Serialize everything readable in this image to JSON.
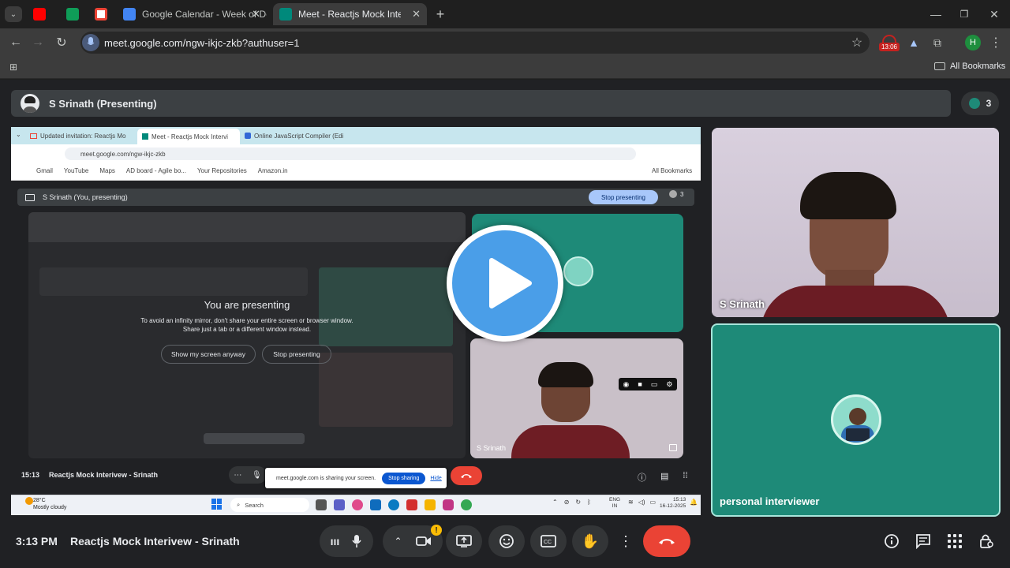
{
  "browser": {
    "tabs": [
      {
        "label": "",
        "icon": "youtube-icon"
      },
      {
        "label": "",
        "icon": "sheets-icon"
      },
      {
        "label": "",
        "icon": "gmail-icon"
      },
      {
        "label": "Google Calendar - Week of Dec",
        "icon": "calendar-icon"
      },
      {
        "label": "Meet - Reactjs Mock Interivew",
        "icon": "meet-icon"
      }
    ],
    "url": "meet.google.com/ngw-ikjc-zkb?authuser=1",
    "record_time": "13:06",
    "profile_initial": "H",
    "all_bookmarks": "All Bookmarks"
  },
  "meet": {
    "presenter_label": "S Srinath (Presenting)",
    "participant_count": "3",
    "clock": "3:13 PM",
    "meeting_title": "Reactjs Mock Interivew - Srinath",
    "tiles": [
      {
        "name": "S Srinath"
      },
      {
        "name": "personal interviewer"
      }
    ]
  },
  "shared_screen": {
    "tabs": [
      "Updated invitation: Reactjs Mo",
      "Meet - Reactjs Mock Intervi",
      "Online JavaScript Compiler (Edi"
    ],
    "url": "meet.google.com/ngw-ikjc-zkb",
    "bookmarks": [
      "Gmail",
      "YouTube",
      "Maps",
      "AD board - Agile bo...",
      "Your Repositories",
      "Amazon.in"
    ],
    "all_bookmarks": "All Bookmarks",
    "presenting_label": "S Srinath (You, presenting)",
    "stop_presenting_top": "Stop presenting",
    "count": "3",
    "you_are_presenting": "You are presenting",
    "warning_line1": "To avoid an infinity mirror, don't share your entire screen or browser window.",
    "warning_line2": "Share just a tab or a different window instead.",
    "show_anyway": "Show my screen anyway",
    "stop_presenting": "Stop presenting",
    "tile_name": "S Srinath",
    "time": "15:13",
    "meeting_title": "Reactjs Mock Interivew - Srinath",
    "sharing_notice": "meet.google.com is sharing your screen.",
    "stop_sharing": "Stop sharing",
    "hide": "Hide",
    "taskbar": {
      "weather_temp": "28°C",
      "weather_desc": "Mostly cloudy",
      "search": "Search",
      "lang1": "ENG",
      "lang2": "IN",
      "clock": "15:13",
      "date": "16-12-2025"
    }
  },
  "colors": {
    "teal_tile": "#1e8a78",
    "end_call": "#ea4335",
    "play_button": "#4a9ee8"
  }
}
